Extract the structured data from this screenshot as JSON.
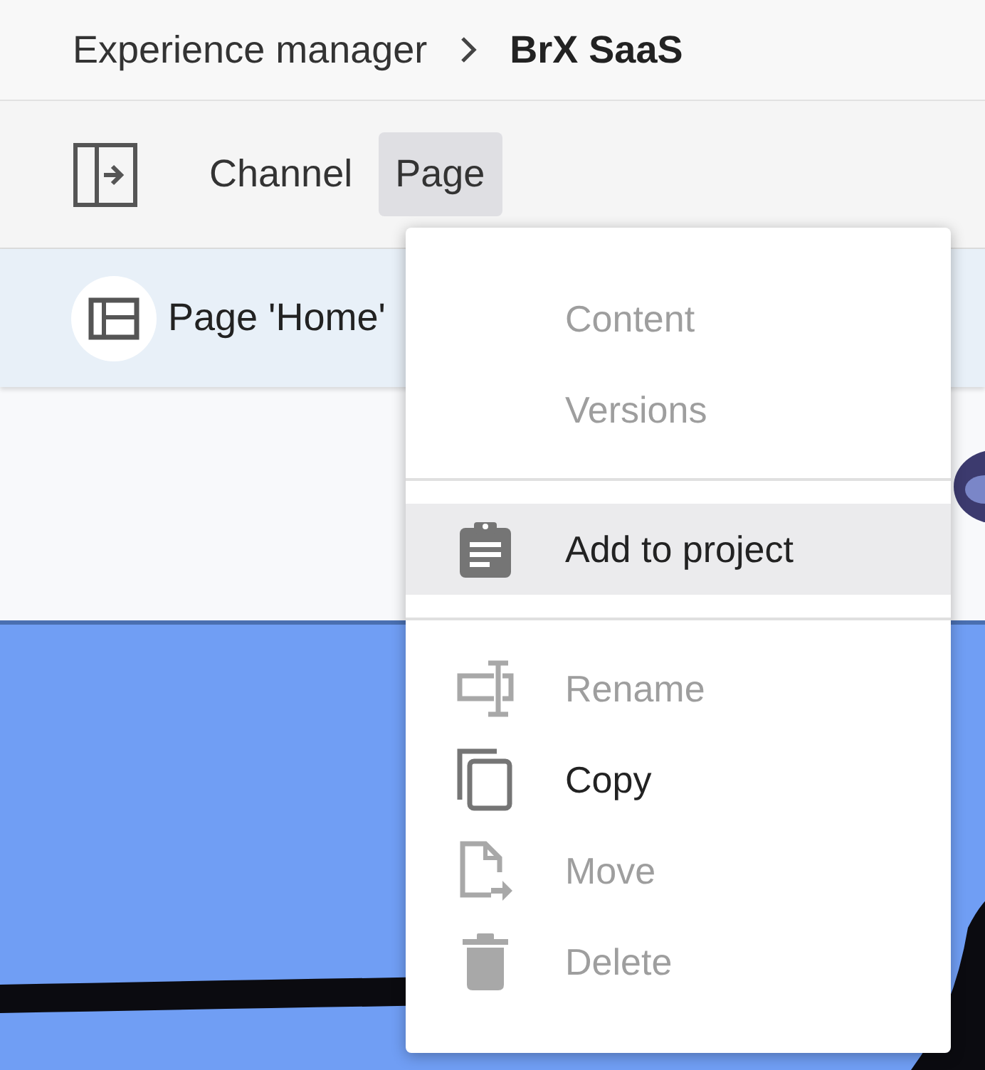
{
  "breadcrumb": {
    "items": [
      "Experience manager",
      "BrX SaaS"
    ]
  },
  "toolbar": {
    "tabs": [
      {
        "label": "Channel",
        "selected": false
      },
      {
        "label": "Page",
        "selected": true
      }
    ]
  },
  "page_bar": {
    "title": "Page 'Home'"
  },
  "menu": {
    "groups": [
      [
        {
          "label": "Content",
          "kind": "plain",
          "disabled": true,
          "selected": false
        },
        {
          "label": "Versions",
          "kind": "plain",
          "disabled": true,
          "selected": false
        }
      ],
      [
        {
          "label": "Add to project",
          "kind": "clipboard",
          "disabled": false,
          "selected": true
        }
      ],
      [
        {
          "label": "Rename",
          "kind": "rename",
          "disabled": true,
          "selected": false
        },
        {
          "label": "Copy",
          "kind": "copy",
          "disabled": false,
          "selected": false
        },
        {
          "label": "Move",
          "kind": "move",
          "disabled": true,
          "selected": false
        },
        {
          "label": "Delete",
          "kind": "delete",
          "disabled": true,
          "selected": false
        }
      ]
    ]
  }
}
